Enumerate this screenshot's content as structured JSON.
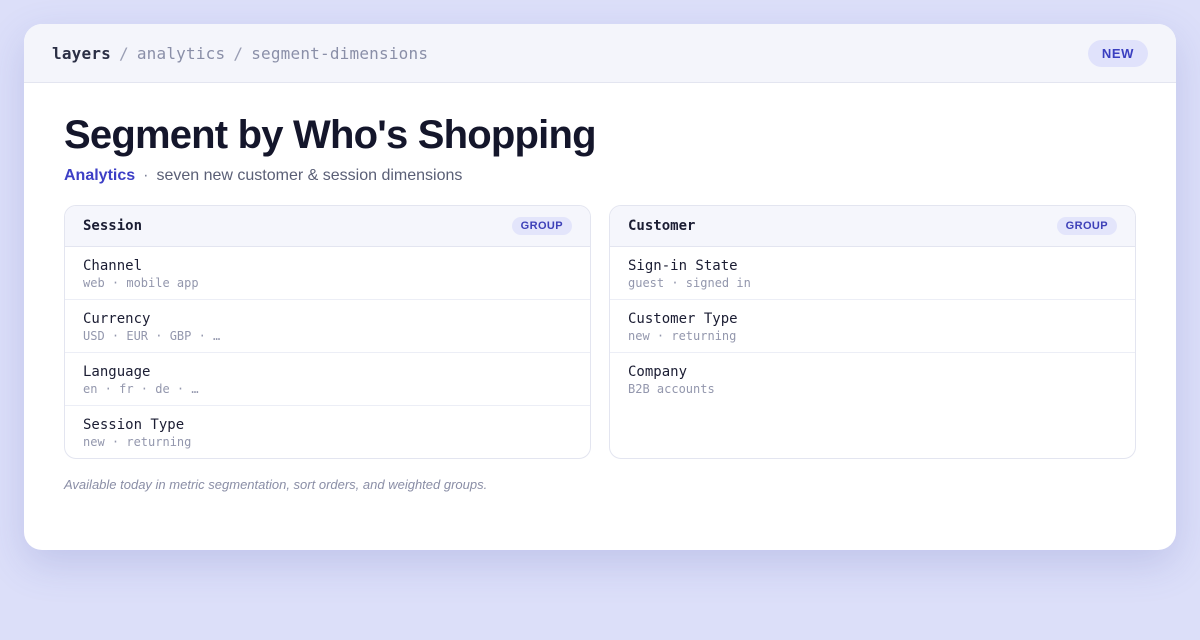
{
  "breadcrumb": {
    "root": "layers",
    "sep": "/",
    "section": "analytics",
    "page": "segment-dimensions"
  },
  "badge": "NEW",
  "title": "Segment by Who's Shopping",
  "subtitle": {
    "category": "Analytics",
    "dot": "·",
    "text": "seven new customer & session dimensions"
  },
  "groups": [
    {
      "title": "Session",
      "tag": "GROUP",
      "rows": [
        {
          "name": "Channel",
          "values": "web · mobile app"
        },
        {
          "name": "Currency",
          "values": "USD · EUR · GBP · …"
        },
        {
          "name": "Language",
          "values": "en · fr · de · …"
        },
        {
          "name": "Session Type",
          "values": "new · returning"
        }
      ]
    },
    {
      "title": "Customer",
      "tag": "GROUP",
      "rows": [
        {
          "name": "Sign-in State",
          "values": "guest · signed in"
        },
        {
          "name": "Customer Type",
          "values": "new · returning"
        },
        {
          "name": "Company",
          "values": "B2B accounts"
        }
      ]
    }
  ],
  "footnote": "Available today in metric segmentation, sort orders, and weighted groups.",
  "colors": {
    "accent": "#3d3fc6",
    "background": "#dcdff9",
    "badge_bg": "#e0e2fb"
  }
}
